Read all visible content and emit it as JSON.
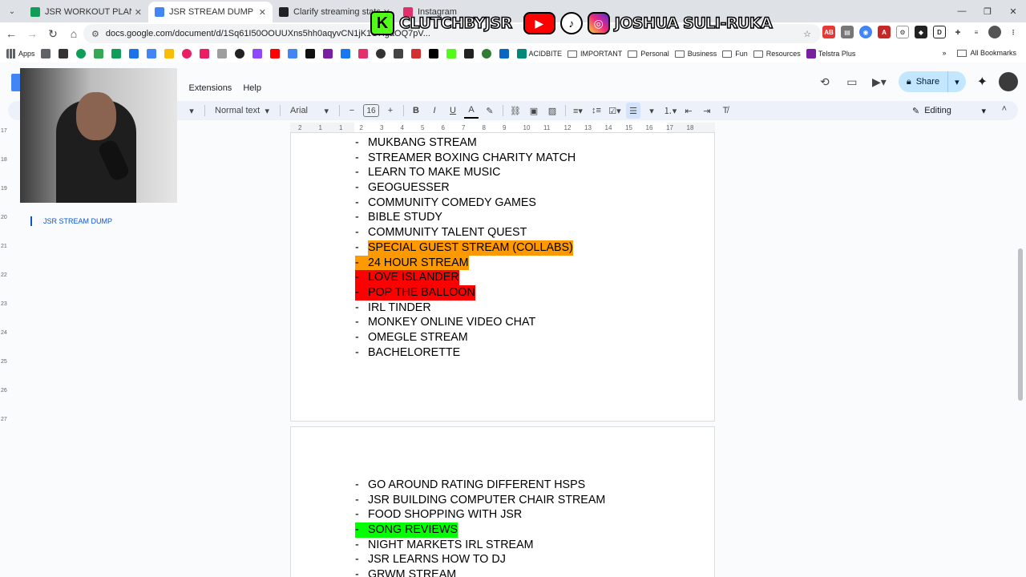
{
  "browser": {
    "tabs": [
      {
        "label": "JSR WORKOUT PLAN - Google",
        "fav_color": "#0f9d58",
        "active": false
      },
      {
        "label": "JSR STREAM DUMP - Google D",
        "fav_color": "#4285f4",
        "active": true
      },
      {
        "label": "Clarify streaming statement",
        "fav_color": "#202124",
        "active": false
      },
      {
        "label": "Instagram",
        "fav_color": "#e1306c",
        "active": false
      }
    ],
    "url": "docs.google.com/document/d/1Sq61I50OOUUXns5hh0aqyvCN1jK1OHgaOQ7pV..."
  },
  "bookmarks": {
    "apps_label": "Apps",
    "items": [
      "ACIDBITE",
      "IMPORTANT",
      "Personal",
      "Business",
      "Fun",
      "Resources",
      "Telstra Plus"
    ],
    "all_label": "All Bookmarks"
  },
  "overlay": {
    "kick_name": "CLUTCHBYJSR",
    "social_name": "JOSHUA SULI-RUKA"
  },
  "docs": {
    "menu": [
      "s",
      "Extensions",
      "Help"
    ],
    "share_label": "Share",
    "style_label": "Normal text",
    "font_label": "Arial",
    "font_size": "16",
    "mode_label": "Editing",
    "outline_item": "JSR STREAM DUMP"
  },
  "ruler_ticks": [
    "2",
    "1",
    "1",
    "2",
    "3",
    "4",
    "5",
    "6",
    "7",
    "8",
    "9",
    "10",
    "11",
    "12",
    "13",
    "14",
    "15",
    "16",
    "17",
    "18"
  ],
  "vruler_ticks": [
    "17",
    "18",
    "19",
    "20",
    "21",
    "22",
    "23",
    "24",
    "25",
    "26",
    "27"
  ],
  "page1_items": [
    {
      "text": "MUKBANG STREAM",
      "hl": ""
    },
    {
      "text": "STREAMER BOXING CHARITY MATCH",
      "hl": ""
    },
    {
      "text": "LEARN TO MAKE MUSIC",
      "hl": ""
    },
    {
      "text": "GEOGUESSER",
      "hl": ""
    },
    {
      "text": "COMMUNITY COMEDY GAMES",
      "hl": ""
    },
    {
      "text": "BIBLE STUDY",
      "hl": ""
    },
    {
      "text": "COMMUNITY TALENT QUEST",
      "hl": ""
    },
    {
      "text": "SPECIAL GUEST STREAM (COLLABS)",
      "hl": "orange-text"
    },
    {
      "text": "24 HOUR STREAM",
      "hl": "orange"
    },
    {
      "text": "LOVE ISLANDER",
      "hl": "red"
    },
    {
      "text": "POP THE BALLOON",
      "hl": "red"
    },
    {
      "text": "IRL TINDER",
      "hl": ""
    },
    {
      "text": "MONKEY ONLINE VIDEO CHAT",
      "hl": ""
    },
    {
      "text": "OMEGLE STREAM",
      "hl": ""
    },
    {
      "text": "BACHELORETTE",
      "hl": ""
    }
  ],
  "page2_items": [
    {
      "text": "GO AROUND RATING DIFFERENT HSPS",
      "hl": ""
    },
    {
      "text": "JSR BUILDING COMPUTER CHAIR STREAM",
      "hl": ""
    },
    {
      "text": "FOOD SHOPPING WITH JSR",
      "hl": ""
    },
    {
      "text": "SONG REVIEWS",
      "hl": "green"
    },
    {
      "text": "NIGHT MARKETS IRL STREAM",
      "hl": ""
    },
    {
      "text": "JSR LEARNS HOW TO DJ",
      "hl": ""
    },
    {
      "text": "GRWM STREAM",
      "hl": ""
    }
  ],
  "colors": {
    "highlight_orange": "#ff9900",
    "highlight_red": "#ff0000",
    "highlight_green": "#00ff00",
    "share_bg": "#c2e7ff"
  }
}
